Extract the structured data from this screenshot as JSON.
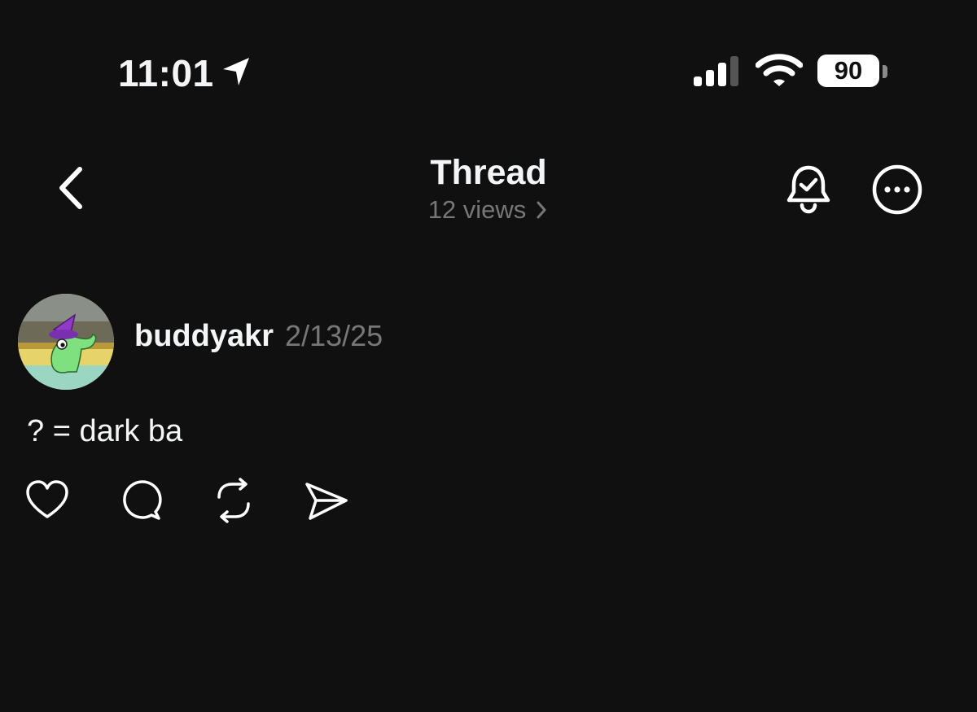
{
  "status_bar": {
    "time": "11:01",
    "battery": "90",
    "icons": [
      "location-arrow-icon",
      "cellular-signal-icon",
      "wifi-icon",
      "battery-icon"
    ]
  },
  "header": {
    "title": "Thread",
    "views": "12 views",
    "icons": [
      "back-chevron-icon",
      "bell-check-icon",
      "more-options-icon"
    ]
  },
  "post": {
    "username": "buddyakr",
    "date": "2/13/25",
    "text": "? = dark ba",
    "actions": [
      "heart-icon",
      "comment-icon",
      "repost-icon",
      "share-icon"
    ]
  },
  "colors": {
    "background": "#101010",
    "primary_text": "#f3f5f7",
    "secondary_text": "#777777"
  }
}
